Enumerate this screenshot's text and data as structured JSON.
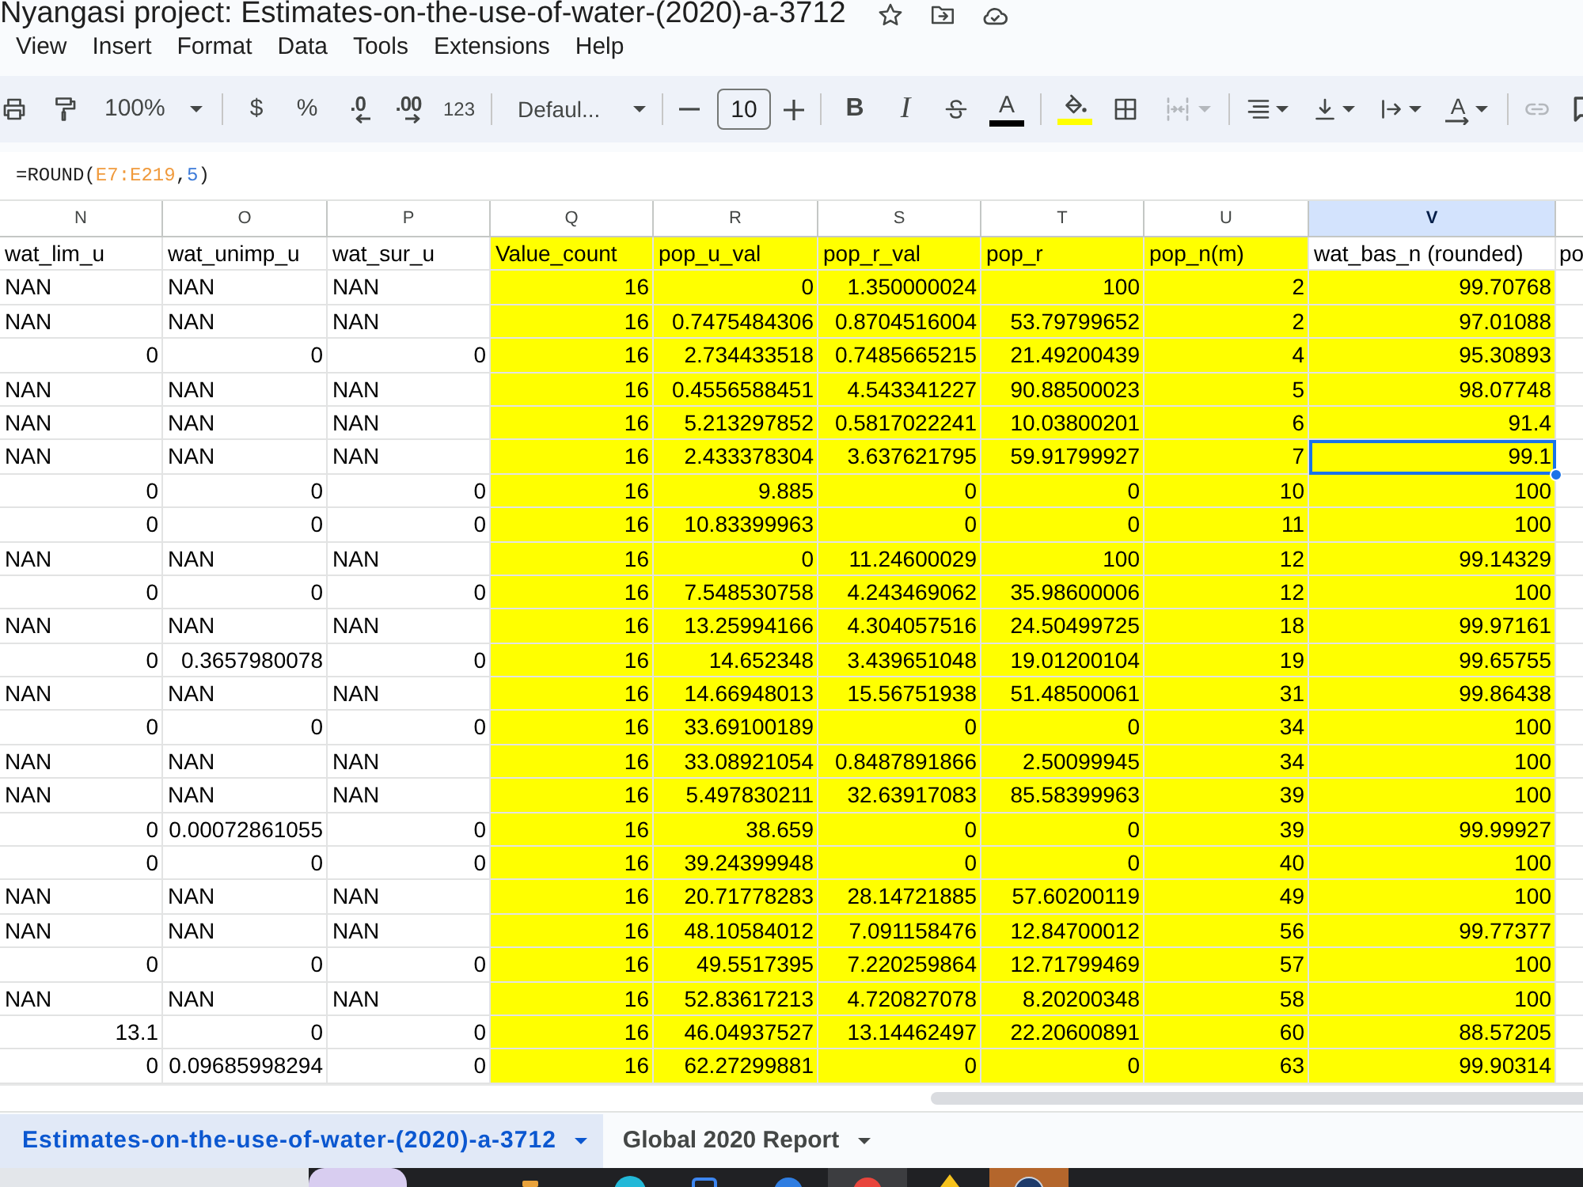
{
  "window": {
    "title": "Nyangasi project: Estimates-on-the-use-of-water-(2020)-a-3712",
    "starred": false
  },
  "menu": [
    "View",
    "Insert",
    "Format",
    "Data",
    "Tools",
    "Extensions",
    "Help"
  ],
  "toolbar": {
    "zoom": "100%",
    "currency": "$",
    "percent": "%",
    "decrease_decimals": ".0",
    "increase_decimals": ".00",
    "number_format": "123",
    "font": "Defaul...",
    "font_size": "10",
    "bold": "B",
    "italic": "I",
    "text_color": {
      "label": "A",
      "color": "#000000"
    },
    "fill_color": {
      "color": "#ffff00"
    },
    "merge": {
      "disabled": true
    },
    "text_rotation": "A",
    "link": {
      "disabled": true
    }
  },
  "formula_bar": {
    "tokens": [
      {
        "text": "=ROUND(",
        "kind": "plain"
      },
      {
        "text": "E7:E219",
        "kind": "range"
      },
      {
        "text": ",",
        "kind": "plain"
      },
      {
        "text": "5",
        "kind": "number"
      },
      {
        "text": ")",
        "kind": "plain"
      }
    ]
  },
  "grid": {
    "columns": [
      {
        "letter": "N",
        "selected": false,
        "highlighted": false
      },
      {
        "letter": "O",
        "selected": false,
        "highlighted": false
      },
      {
        "letter": "P",
        "selected": false,
        "highlighted": false
      },
      {
        "letter": "Q",
        "selected": false,
        "highlighted": true
      },
      {
        "letter": "R",
        "selected": false,
        "highlighted": true
      },
      {
        "letter": "S",
        "selected": false,
        "highlighted": true
      },
      {
        "letter": "T",
        "selected": false,
        "highlighted": true
      },
      {
        "letter": "U",
        "selected": false,
        "highlighted": true
      },
      {
        "letter": "V",
        "selected": true,
        "highlighted": true
      },
      {
        "selected": false,
        "highlighted": false
      }
    ],
    "header_row": [
      {
        "text": "wat_lim_u",
        "highlighted": false
      },
      {
        "text": "wat_unimp_u",
        "highlighted": false
      },
      {
        "text": "wat_sur_u",
        "highlighted": false
      },
      {
        "text": "Value_count",
        "highlighted": true
      },
      {
        "text": "pop_u_val",
        "highlighted": true
      },
      {
        "text": "pop_r_val",
        "highlighted": true
      },
      {
        "text": "pop_r",
        "highlighted": true
      },
      {
        "text": "pop_n(m)",
        "highlighted": true
      },
      {
        "text": "wat_bas_n (rounded)",
        "highlighted": false
      },
      {
        "text": "po",
        "highlighted": false
      }
    ],
    "rows": [
      {
        "cells": [
          "NAN",
          "NAN",
          "NAN",
          "16",
          "0",
          "1.350000024",
          "100",
          "2",
          "99.70768"
        ],
        "selected": false
      },
      {
        "cells": [
          "NAN",
          "NAN",
          "NAN",
          "16",
          "0.7475484306",
          "0.8704516004",
          "53.79799652",
          "2",
          "97.01088"
        ],
        "selected": false
      },
      {
        "cells": [
          "0",
          "0",
          "0",
          "16",
          "2.734433518",
          "0.7485665215",
          "21.49200439",
          "4",
          "95.30893"
        ],
        "selected": false
      },
      {
        "cells": [
          "NAN",
          "NAN",
          "NAN",
          "16",
          "0.4556588451",
          "4.543341227",
          "90.88500023",
          "5",
          "98.07748"
        ],
        "selected": false
      },
      {
        "cells": [
          "NAN",
          "NAN",
          "NAN",
          "16",
          "5.213297852",
          "0.5817022241",
          "10.03800201",
          "6",
          "91.4"
        ],
        "selected": false
      },
      {
        "cells": [
          "NAN",
          "NAN",
          "NAN",
          "16",
          "2.433378304",
          "3.637621795",
          "59.91799927",
          "7",
          "99.1"
        ],
        "selected": true
      },
      {
        "cells": [
          "0",
          "0",
          "0",
          "16",
          "9.885",
          "0",
          "0",
          "10",
          "100"
        ],
        "selected": false
      },
      {
        "cells": [
          "0",
          "0",
          "0",
          "16",
          "10.83399963",
          "0",
          "0",
          "11",
          "100"
        ],
        "selected": false
      },
      {
        "cells": [
          "NAN",
          "NAN",
          "NAN",
          "16",
          "0",
          "11.24600029",
          "100",
          "12",
          "99.14329"
        ],
        "selected": false
      },
      {
        "cells": [
          "0",
          "0",
          "0",
          "16",
          "7.548530758",
          "4.243469062",
          "35.98600006",
          "12",
          "100"
        ],
        "selected": false
      },
      {
        "cells": [
          "NAN",
          "NAN",
          "NAN",
          "16",
          "13.25994166",
          "4.304057516",
          "24.50499725",
          "18",
          "99.97161"
        ],
        "selected": false
      },
      {
        "cells": [
          "0",
          "0.3657980078",
          "0",
          "16",
          "14.652348",
          "3.439651048",
          "19.01200104",
          "19",
          "99.65755"
        ],
        "selected": false
      },
      {
        "cells": [
          "NAN",
          "NAN",
          "NAN",
          "16",
          "14.66948013",
          "15.56751938",
          "51.48500061",
          "31",
          "99.86438"
        ],
        "selected": false
      },
      {
        "cells": [
          "0",
          "0",
          "0",
          "16",
          "33.69100189",
          "0",
          "0",
          "34",
          "100"
        ],
        "selected": false
      },
      {
        "cells": [
          "NAN",
          "NAN",
          "NAN",
          "16",
          "33.08921054",
          "0.8487891866",
          "2.50099945",
          "34",
          "100"
        ],
        "selected": false
      },
      {
        "cells": [
          "NAN",
          "NAN",
          "NAN",
          "16",
          "5.497830211",
          "32.63917083",
          "85.58399963",
          "39",
          "100"
        ],
        "selected": false
      },
      {
        "cells": [
          "0",
          "0.00072861055",
          "0",
          "16",
          "38.659",
          "0",
          "0",
          "39",
          "99.99927"
        ],
        "selected": false
      },
      {
        "cells": [
          "0",
          "0",
          "0",
          "16",
          "39.24399948",
          "0",
          "0",
          "40",
          "100"
        ],
        "selected": false
      },
      {
        "cells": [
          "NAN",
          "NAN",
          "NAN",
          "16",
          "20.71778283",
          "28.14721885",
          "57.60200119",
          "49",
          "100"
        ],
        "selected": false
      },
      {
        "cells": [
          "NAN",
          "NAN",
          "NAN",
          "16",
          "48.10584012",
          "7.091158476",
          "12.84700012",
          "56",
          "99.77377"
        ],
        "selected": false
      },
      {
        "cells": [
          "0",
          "0",
          "0",
          "16",
          "49.5517395",
          "7.220259864",
          "12.71799469",
          "57",
          "100"
        ],
        "selected": false
      },
      {
        "cells": [
          "NAN",
          "NAN",
          "NAN",
          "16",
          "52.83617213",
          "4.720827078",
          "8.20200348",
          "58",
          "100"
        ],
        "selected": false
      },
      {
        "cells": [
          "13.1",
          "0",
          "0",
          "16",
          "46.04937527",
          "13.14462497",
          "22.20600891",
          "60",
          "88.57205"
        ],
        "selected": false
      },
      {
        "cells": [
          "0",
          "0.09685998294",
          "0",
          "16",
          "62.27299881",
          "0",
          "0",
          "63",
          "99.90314"
        ],
        "selected": false
      }
    ]
  },
  "sheet_tabs": [
    {
      "label": "Estimates-on-the-use-of-water-(2020)-a-3712",
      "selected": true
    },
    {
      "label": "Global 2020 Report",
      "selected": false
    }
  ]
}
